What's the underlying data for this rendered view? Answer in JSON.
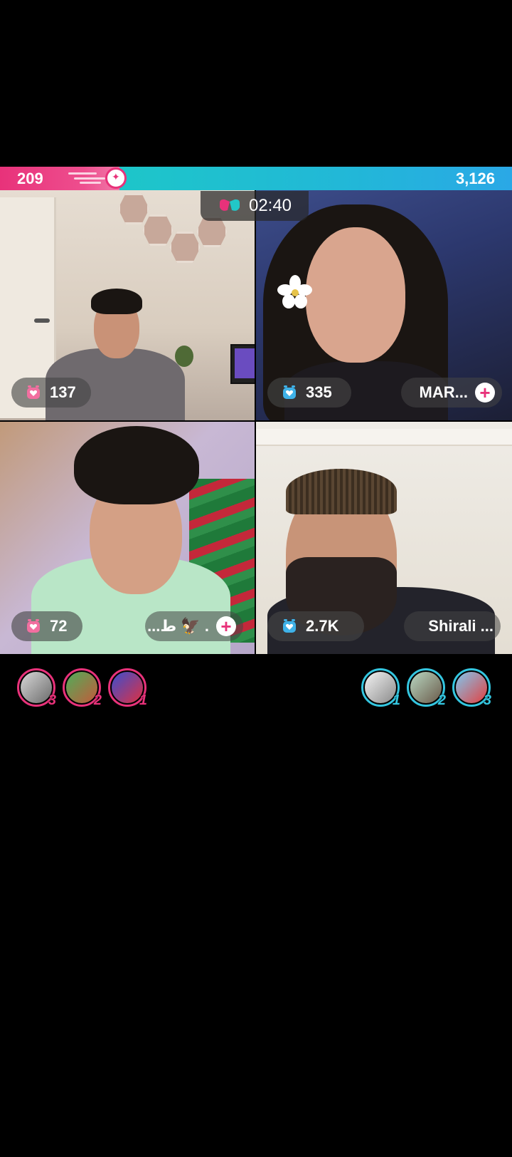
{
  "score": {
    "left": "209",
    "right": "3,126"
  },
  "timer": {
    "time": "02:40",
    "icon": "battle-gloves-icon"
  },
  "tiles": [
    {
      "points": "137",
      "name": "",
      "team": "red",
      "icon": "alarm-heart-icon"
    },
    {
      "points": "335",
      "name": "MAR...",
      "team": "blue",
      "icon": "alarm-heart-icon"
    },
    {
      "points": "72",
      "name": "...ط 🦅 .",
      "team": "red",
      "icon": "alarm-heart-icon"
    },
    {
      "points": "2.7K",
      "name": "Shirali ...",
      "team": "blue",
      "icon": "alarm-heart-icon"
    }
  ],
  "gifters_left": [
    {
      "rank": "3"
    },
    {
      "rank": "2"
    },
    {
      "rank": "1"
    }
  ],
  "gifters_right": [
    {
      "rank": "1"
    },
    {
      "rank": "2"
    },
    {
      "rank": "3"
    }
  ],
  "colors": {
    "red_team": "#e8327a",
    "blue_team": "#22b7d8"
  }
}
